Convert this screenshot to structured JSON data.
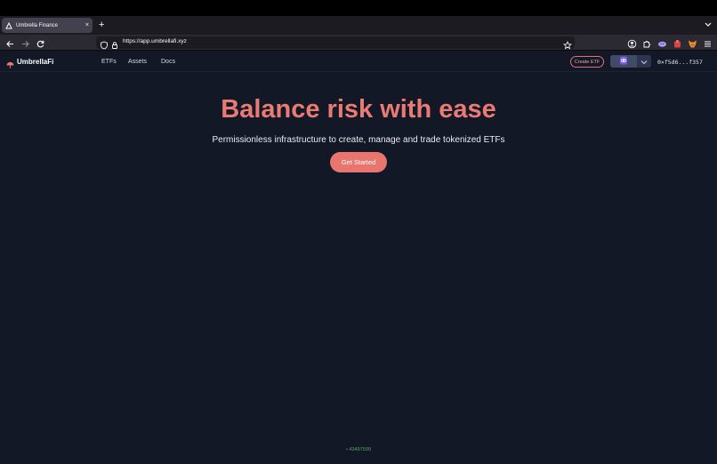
{
  "browser": {
    "tab": {
      "title": "Umbrella Finance",
      "close_label": "×",
      "favicon": "umbrella-logo-icon"
    },
    "new_tab_label": "+",
    "url": "https://app.umbrellafi.xyz",
    "icons": [
      "back-arrow-icon",
      "forward-arrow-icon",
      "reload-icon",
      "shield-icon",
      "lock-icon",
      "bookmark-star-icon",
      "account-icon",
      "extensions-icon",
      "phantom-wallet-icon",
      "extension-red-icon",
      "metamask-fox-icon",
      "hamburger-menu-icon",
      "tab-list-chevron-icon"
    ]
  },
  "app": {
    "brand": "UmbrellaFi",
    "nav": [
      {
        "label": "ETFs"
      },
      {
        "label": "Assets"
      },
      {
        "label": "Docs"
      }
    ],
    "create_etf_label": "Create ETF",
    "chain_icon": "chain-link-icon",
    "wallet_address": "0×f5d6...f357",
    "hero": {
      "title": "Balance risk with ease",
      "subtitle": "Permissionless infrastructure to create, manage and trade tokenized ETFs",
      "cta_label": "Get Started"
    },
    "block_number": "• 43497599"
  },
  "colors": {
    "app_background": "#131826",
    "accent": "#ea7a74",
    "block_status": "#4dab5f"
  }
}
